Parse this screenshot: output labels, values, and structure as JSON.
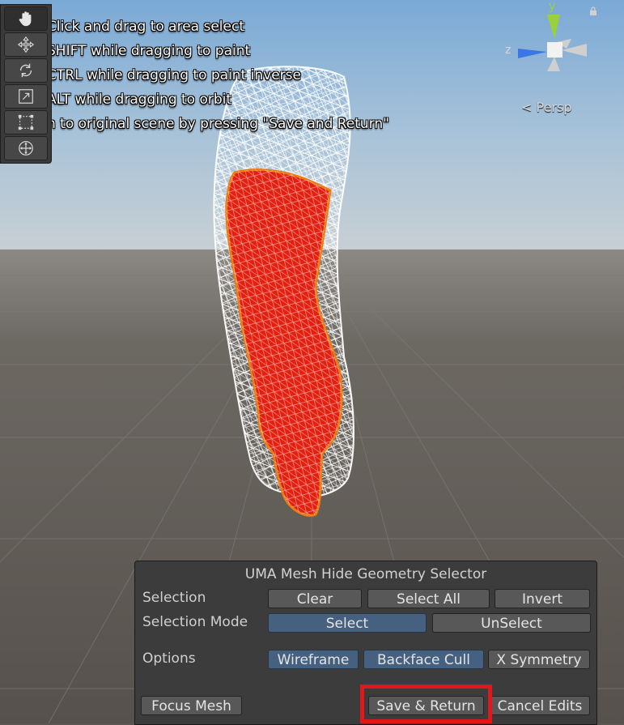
{
  "overlay": {
    "hints": [
      "Click and drag to area select",
      "SHIFT while dragging to paint",
      "CTRL while dragging to paint inverse",
      "ALT while dragging to orbit",
      "n to original scene by pressing \"Save and Return\""
    ]
  },
  "tools": [
    {
      "name": "hand-tool",
      "icon": "hand-icon"
    },
    {
      "name": "move-tool",
      "icon": "move-icon"
    },
    {
      "name": "rotate-tool",
      "icon": "rotate-icon"
    },
    {
      "name": "scale-tool",
      "icon": "scale-icon"
    },
    {
      "name": "rect-tool",
      "icon": "rect-icon"
    },
    {
      "name": "transform-tool",
      "icon": "transform-icon"
    }
  ],
  "gizmo": {
    "y_label": "y",
    "z_label": "z",
    "view_label": "< Persp",
    "colors": {
      "y": "#9ad13b",
      "z": "#3a76e6",
      "neutral": "#cfcfcf"
    }
  },
  "panel": {
    "title": "UMA Mesh Hide Geometry Selector",
    "selection_label": "Selection",
    "clear": "Clear",
    "select_all": "Select All",
    "invert": "Invert",
    "mode_label": "Selection Mode",
    "select": "Select",
    "unselect": "UnSelect",
    "options_label": "Options",
    "wireframe": "Wireframe",
    "backface_cull": "Backface Cull",
    "x_symmetry": "X Symmetry",
    "focus_mesh": "Focus Mesh",
    "save_return": "Save & Return",
    "cancel_edits": "Cancel Edits"
  },
  "colors": {
    "selection_fill": "#e3200f",
    "selection_outline": "#f07a12",
    "toggle_on": "#46607f",
    "highlight": "#e0181e"
  }
}
